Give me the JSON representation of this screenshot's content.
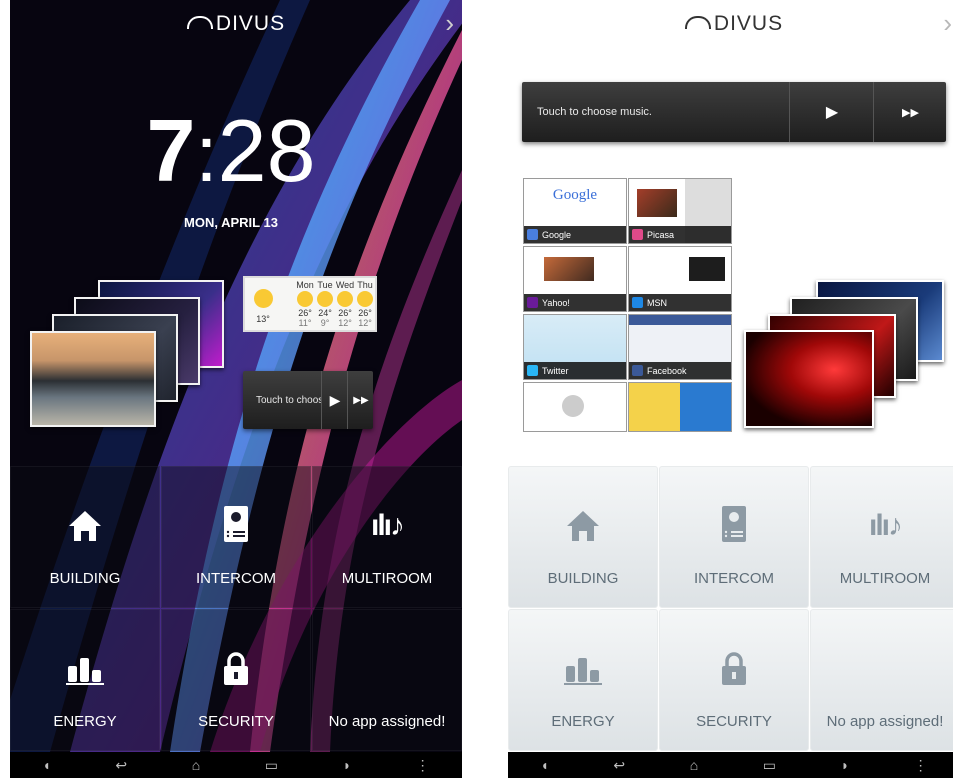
{
  "brand": {
    "name": "DIVUS"
  },
  "dark_screen": {
    "time_hour": "7",
    "time_sep": ":",
    "time_minutes": "28",
    "date": "MON, APRIL 13",
    "weather": {
      "current": "13°",
      "days": [
        {
          "day": "Mon",
          "high": "26°",
          "low": "11°"
        },
        {
          "day": "Tue",
          "high": "24°",
          "low": "9°"
        },
        {
          "day": "Wed",
          "high": "26°",
          "low": "12°"
        },
        {
          "day": "Thu",
          "high": "26°",
          "low": "12°"
        }
      ]
    },
    "music_label": "Touch to choose music."
  },
  "light_screen": {
    "music_label": "Touch to choose music.",
    "bookmarks": [
      {
        "label": "Google",
        "color": "#4a7fe0"
      },
      {
        "label": "Picasa",
        "color": "#e04a8a"
      },
      {
        "label": "Yahoo!",
        "color": "#6a1b9a"
      },
      {
        "label": "MSN",
        "color": "#1e88e5"
      },
      {
        "label": "Twitter",
        "color": "#29b6f6"
      },
      {
        "label": "Facebook",
        "color": "#3b5998"
      }
    ]
  },
  "apps": [
    {
      "label": "BUILDING",
      "icon": "house-icon"
    },
    {
      "label": "INTERCOM",
      "icon": "intercom-icon"
    },
    {
      "label": "MULTIROOM",
      "icon": "music-note-icon"
    },
    {
      "label": "ENERGY",
      "icon": "bar-chart-icon"
    },
    {
      "label": "SECURITY",
      "icon": "padlock-icon"
    },
    {
      "label": "No app assigned!",
      "icon": ""
    }
  ],
  "navbar": [
    "volume-down-icon",
    "back-icon",
    "home-icon",
    "recent-apps-icon",
    "volume-up-icon",
    "menu-icon"
  ],
  "colors": {
    "dark_bg": "#070510",
    "light_tile": "#e4e8ea",
    "accent_icon": "#8d9aa4"
  }
}
